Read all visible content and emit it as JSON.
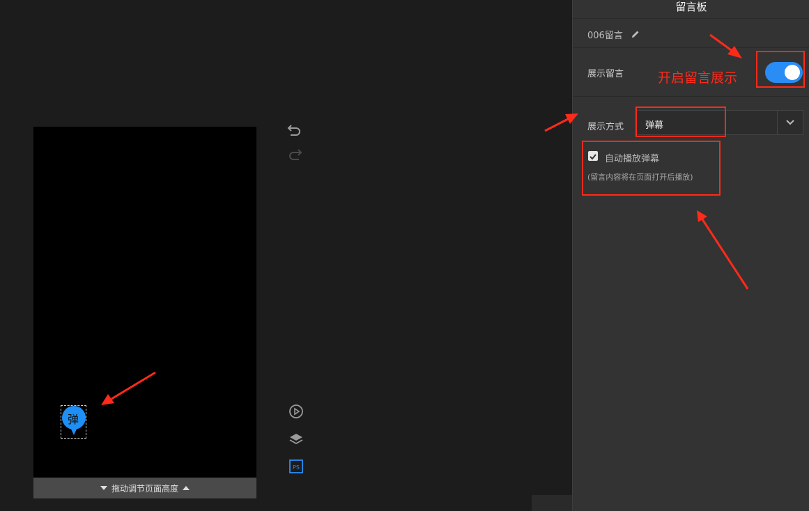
{
  "canvas": {
    "background": "#000000",
    "resize_bar_label": "拖动调节页面高度",
    "danmu_widget_char": "弹",
    "danmu_widget_color": "#1e8ff5"
  },
  "toolbar": {
    "icons": [
      "undo-icon",
      "redo-icon",
      "preview-icon",
      "layers-icon",
      "ps-icon"
    ],
    "ps_label": "PS"
  },
  "panel": {
    "title": "留言板",
    "component_name": "006留言",
    "show_label": "展示留言",
    "show_enabled": true,
    "mode_label": "展示方式",
    "mode_value": "弹幕",
    "autoplay_label": "自动播放弹幕",
    "autoplay_checked": true,
    "autoplay_hint": "(留言内容将在页面打开后播放)",
    "accent_color": "#2a8df5"
  },
  "annotations": {
    "toggle_note": "开启留言展示",
    "color": "#ff2a1a"
  }
}
